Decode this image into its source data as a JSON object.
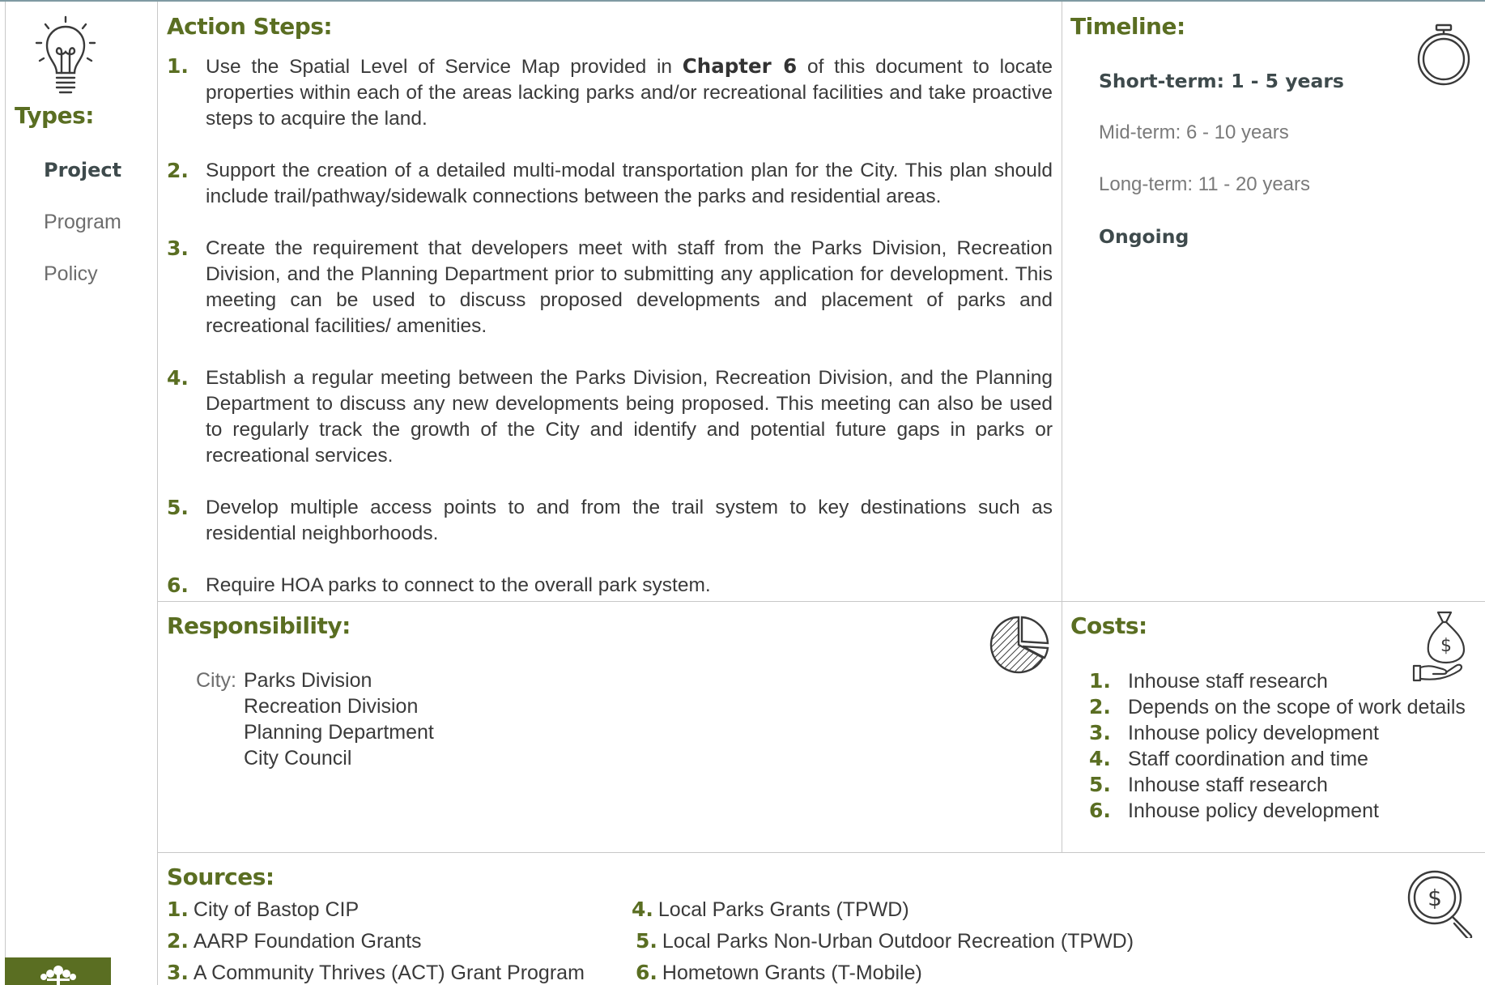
{
  "types": {
    "heading": "Types:",
    "items": [
      {
        "label": "Project",
        "active": true
      },
      {
        "label": "Program",
        "active": false
      },
      {
        "label": "Policy",
        "active": false
      }
    ]
  },
  "action_steps": {
    "heading": "Action Steps:",
    "items": [
      {
        "num": "1.",
        "pre": "Use the Spatial Level of Service Map provided in ",
        "bold": "Chapter 6",
        "post": " of this document to locate properties within each of the areas lacking parks and/or recreational facilities and take proactive steps to acquire the land."
      },
      {
        "num": "2.",
        "text": "Support the creation of a detailed multi-modal transportation plan for the City. This plan should include trail/pathway/sidewalk connections between the parks and residential areas."
      },
      {
        "num": "3.",
        "text": "Create the requirement that developers meet with staff from the Parks Division, Recreation Division, and the Planning Department prior to submitting any application for development. This meeting can be used to discuss proposed developments and placement of parks and recreational facilities/ amenities."
      },
      {
        "num": "4.",
        "text": "Establish a regular meeting between the Parks Division, Recreation Division, and the Planning Department to discuss any new developments being proposed. This meeting can also be used to regularly track the growth of the City and identify and potential future gaps in parks or recreational services."
      },
      {
        "num": "5.",
        "text": "Develop multiple access points to and from the trail system to key destinations such as residential neighborhoods."
      },
      {
        "num": "6.",
        "text": "Require HOA parks to connect to the overall park system."
      }
    ]
  },
  "timeline": {
    "heading": "Timeline:",
    "items": [
      {
        "label": "Short-term:  1 - 5 years",
        "active": true
      },
      {
        "label": "Mid-term:  6 - 10 years",
        "active": false
      },
      {
        "label": "Long-term:  11 - 20 years",
        "active": false
      },
      {
        "label": "Ongoing",
        "active": true
      }
    ]
  },
  "responsibility": {
    "heading": "Responsibility:",
    "label": "City:",
    "items": [
      "Parks Division",
      "Recreation Division",
      "Planning Department",
      "City Council"
    ]
  },
  "costs": {
    "heading": "Costs:",
    "items": [
      {
        "num": "1.",
        "text": "Inhouse staff research"
      },
      {
        "num": "2.",
        "text": "Depends on the scope of work details"
      },
      {
        "num": "3.",
        "text": "Inhouse policy development"
      },
      {
        "num": "4.",
        "text": "Staff coordination and time"
      },
      {
        "num": "5.",
        "text": "Inhouse staff research"
      },
      {
        "num": "6.",
        "text": "Inhouse policy development"
      }
    ]
  },
  "sources": {
    "heading": "Sources:",
    "items": [
      {
        "num": "1.",
        "text": "City of Bastop CIP"
      },
      {
        "num": "2.",
        "text": "AARP Foundation Grants"
      },
      {
        "num": "3.",
        "text": "A Community Thrives (ACT) Grant Program"
      },
      {
        "num": "4.",
        "text": "Local Parks Grants (TPWD)"
      },
      {
        "num": "5.",
        "text": "Local Parks Non-Urban Outdoor Recreation (TPWD)"
      },
      {
        "num": "6.",
        "text": "Hometown Grants (T-Mobile)"
      }
    ]
  },
  "colors": {
    "heading_green": "#5a6e22",
    "active_text": "#3e4a4c",
    "inactive_text": "#7a7a7a",
    "top_rule": "#7f9aa3"
  },
  "icons": [
    "lightbulb-icon",
    "stopwatch-icon",
    "pie-chart-icon",
    "money-bag-hand-icon",
    "magnifier-dollar-icon",
    "tree-logo-icon"
  ]
}
